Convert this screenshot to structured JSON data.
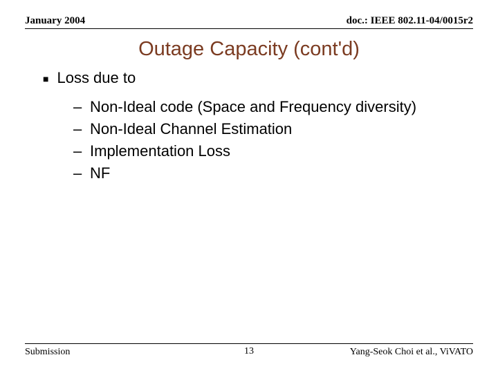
{
  "header": {
    "left": "January 2004",
    "right": "doc.: IEEE 802.11-04/0015r2"
  },
  "title": "Outage Capacity (cont'd)",
  "content": {
    "bullet1": {
      "symbol": "■",
      "text": "Loss due to"
    },
    "subitems": [
      {
        "dash": "–",
        "text": "Non-Ideal code (Space and Frequency diversity)"
      },
      {
        "dash": "–",
        "text": "Non-Ideal Channel Estimation"
      },
      {
        "dash": "–",
        "text": "Implementation Loss"
      },
      {
        "dash": "–",
        "text": "NF"
      }
    ]
  },
  "footer": {
    "left": "Submission",
    "center": "13",
    "right": "Yang-Seok Choi et al., ViVATO"
  }
}
